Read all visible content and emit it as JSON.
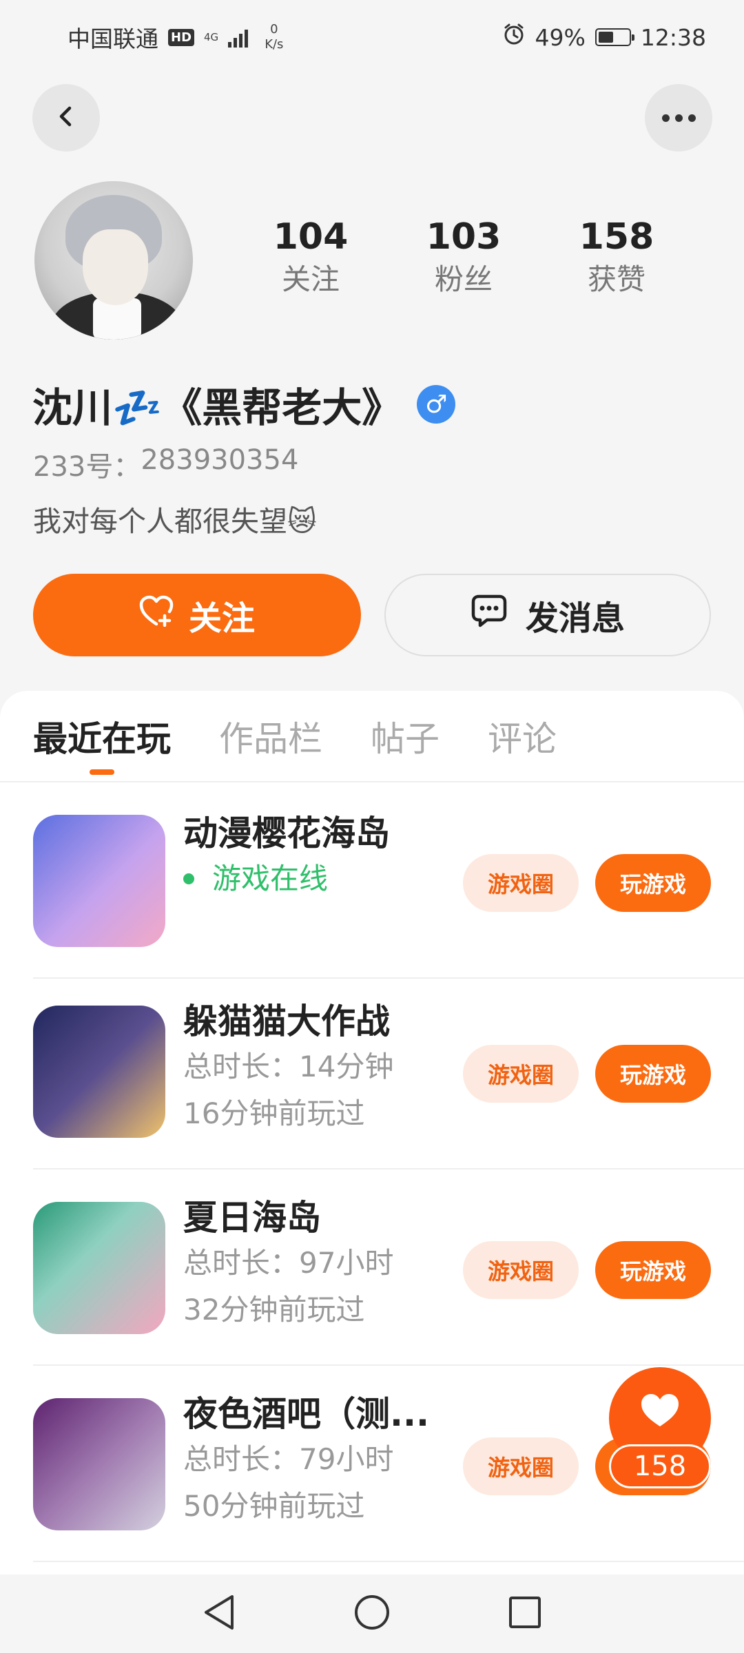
{
  "status_bar": {
    "carrier": "中国联通",
    "hd": "HD",
    "net_type": "4G",
    "speed_value": "0",
    "speed_unit": "K/s",
    "battery": "49%",
    "time": "12:38"
  },
  "profile": {
    "stats": [
      {
        "value": "104",
        "label": "关注"
      },
      {
        "value": "103",
        "label": "粉丝"
      },
      {
        "value": "158",
        "label": "获赞"
      }
    ],
    "username": "沈川💤《黑帮老大》",
    "gender_symbol": "♂",
    "uid_label": "233号：",
    "uid_value": "283930354",
    "bio": "我对每个人都很失望😿",
    "follow_label": "关注",
    "message_label": "发消息"
  },
  "tabs": [
    "最近在玩",
    "作品栏",
    "帖子",
    "评论"
  ],
  "games": [
    {
      "title": "动漫樱花海岛",
      "line1": "游戏在线",
      "line2": "",
      "circle_label": "游戏圈",
      "play_label": "玩游戏",
      "colors": [
        "#6a7de8",
        "#f1a3c8"
      ]
    },
    {
      "title": "躲猫猫大作战",
      "line1": "总时长：14分钟",
      "line2": "16分钟前玩过",
      "circle_label": "游戏圈",
      "play_label": "玩游戏",
      "colors": [
        "#2b2f6b",
        "#f2c56a"
      ]
    },
    {
      "title": "夏日海岛",
      "line1": "总时长：97小时",
      "line2": "32分钟前玩过",
      "circle_label": "游戏圈",
      "play_label": "玩游戏",
      "colors": [
        "#2d9c7a",
        "#f4a8c0"
      ]
    },
    {
      "title": "夜色酒吧（测...",
      "line1": "总时长：79小时",
      "line2": "50分钟前玩过",
      "circle_label": "游戏圈",
      "play_label": "玩游戏",
      "colors": [
        "#6b2a7a",
        "#c9c4d6"
      ]
    }
  ],
  "like_count": "158",
  "colors": {
    "accent": "#fb6b10",
    "online": "#2fbf6a",
    "gender": "#3d8ef0"
  }
}
